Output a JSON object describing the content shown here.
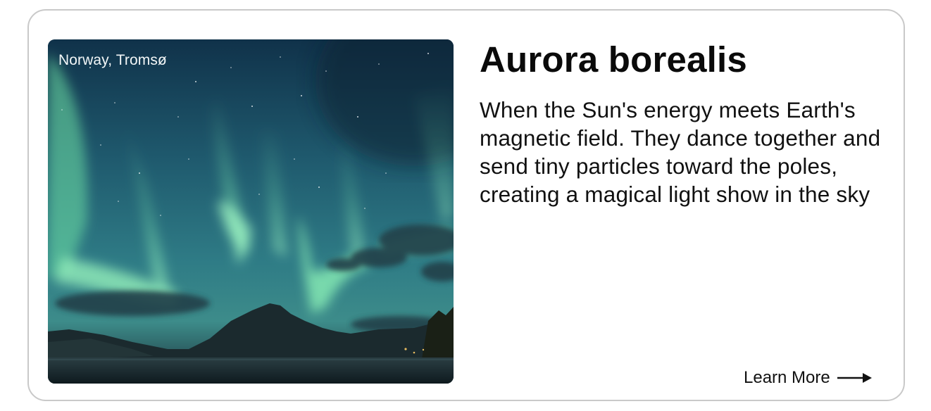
{
  "card": {
    "location": "Norway, Tromsø",
    "title": "Aurora borealis",
    "description": "When the Sun's energy meets Earth's magnetic field. They dance together and send tiny particles toward the poles, creating a magical light show in the sky",
    "cta_label": "Learn More",
    "cta_icon": "arrow-right-icon",
    "photo_subject": "aurora-photo"
  },
  "colors": {
    "border": "#c9c9c9",
    "text": "#111111",
    "aurora_green": "#7ff0b2",
    "sky_top": "#0f2f45",
    "sky_mid": "#2f7a8a"
  }
}
